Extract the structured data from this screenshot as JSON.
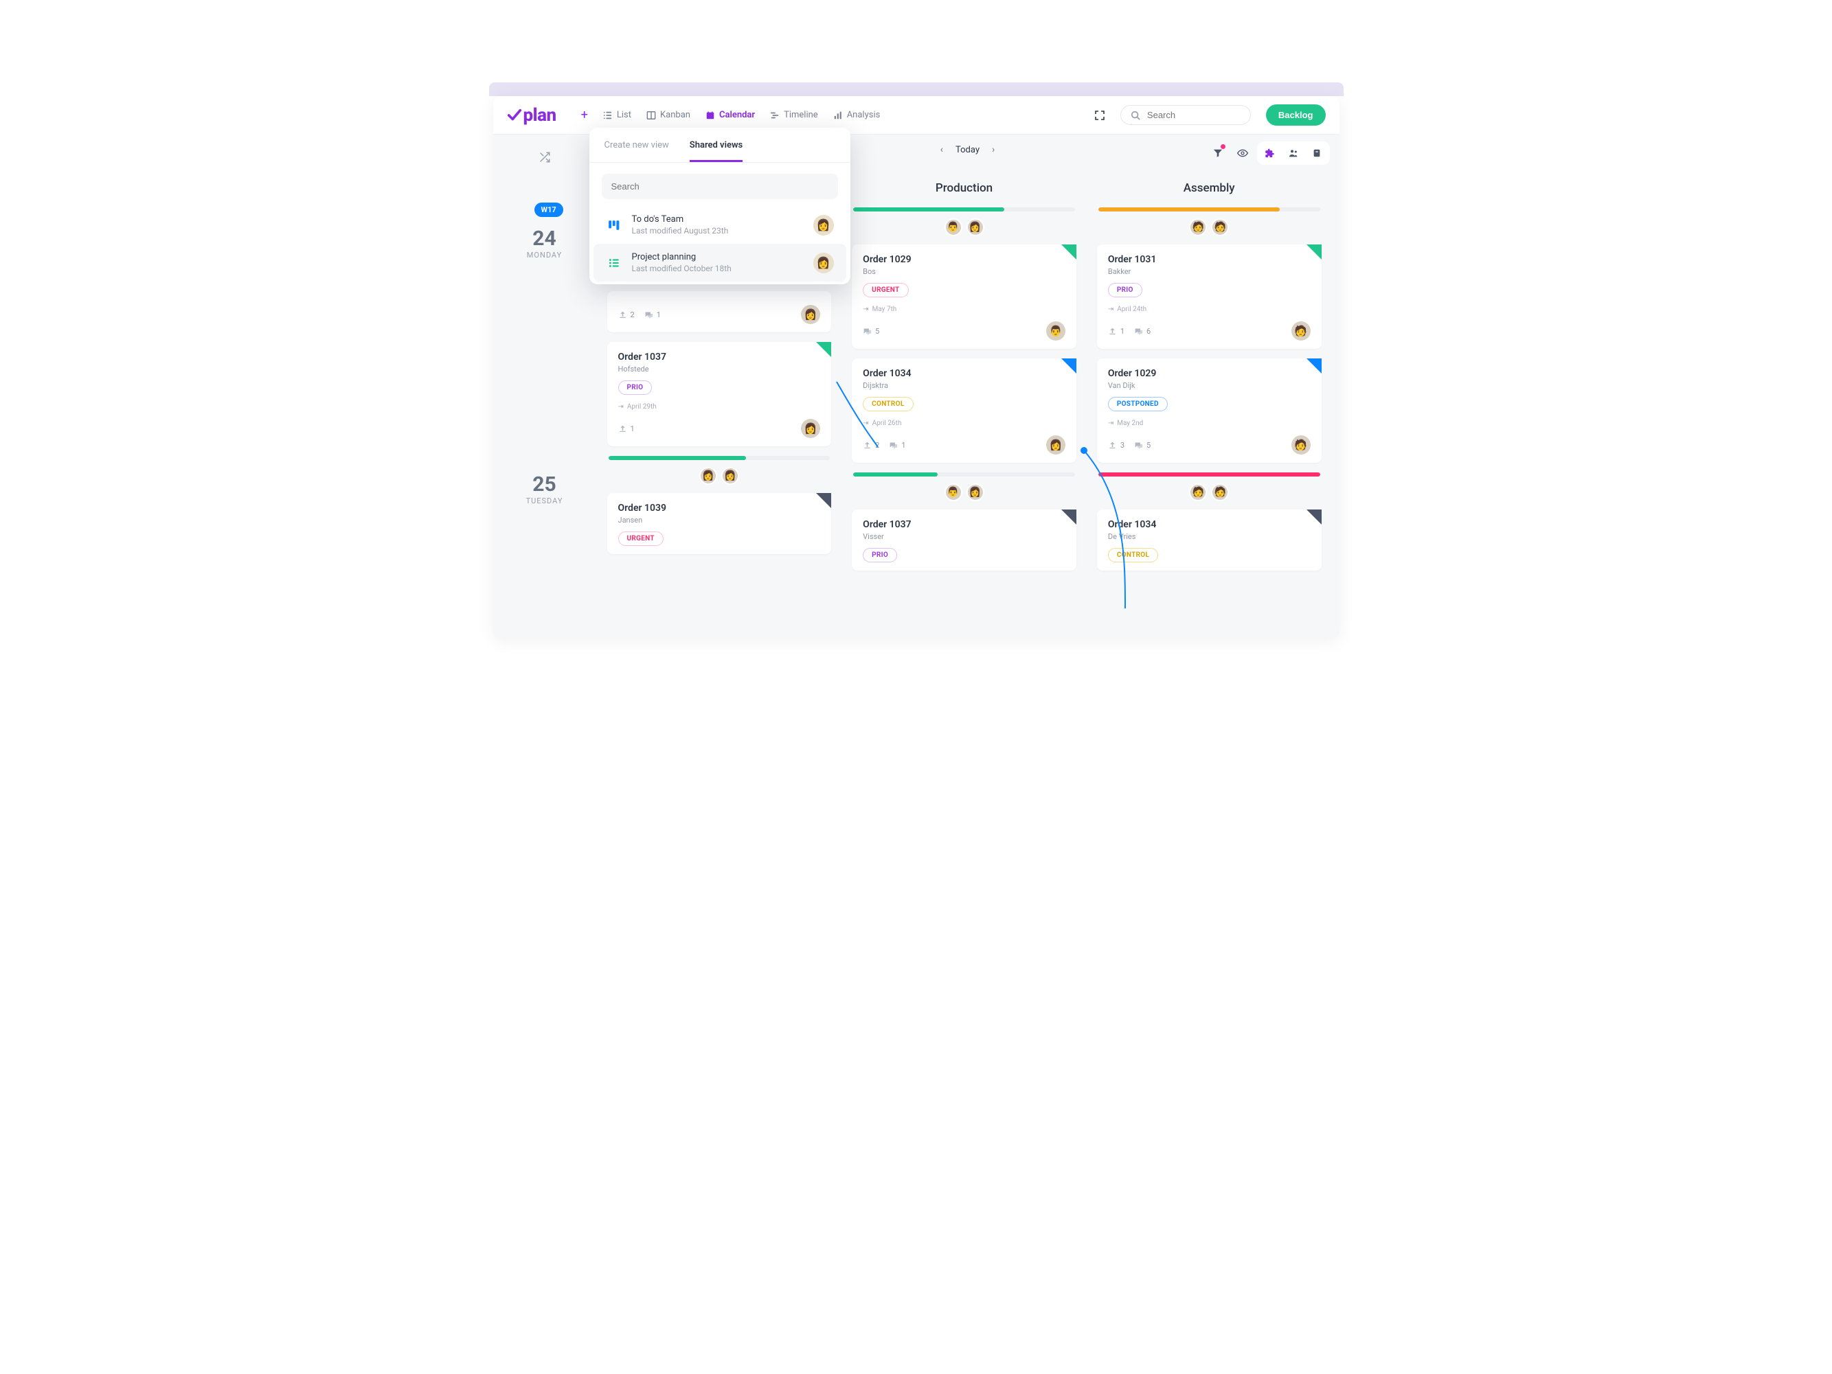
{
  "brand": "plan",
  "nav": {
    "list": "List",
    "kanban": "Kanban",
    "calendar": "Calendar",
    "timeline": "Timeline",
    "analysis": "Analysis"
  },
  "search_placeholder": "Search",
  "backlog_label": "Backlog",
  "today_label": "Today",
  "week_badge": "W17",
  "days": [
    {
      "num": "24",
      "name": "MONDAY"
    },
    {
      "num": "25",
      "name": "TUESDAY"
    }
  ],
  "dropdown": {
    "tab_create": "Create new view",
    "tab_shared": "Shared views",
    "search_placeholder": "Search",
    "items": [
      {
        "title": "To do's Team",
        "sub": "Last modified August 23th"
      },
      {
        "title": "Project planning",
        "sub": "Last modified October 18th"
      }
    ]
  },
  "columns": {
    "production": "Production",
    "assembly": "Assembly"
  },
  "col1": {
    "day1": {
      "card2": {
        "title": "Order 1037",
        "sub": "Hofstede",
        "tag": "PRIO",
        "date": "April 29th",
        "uploads": "1"
      },
      "foot_uploads": "2",
      "foot_comments": "1"
    },
    "day2": {
      "card1": {
        "title": "Order 1039",
        "sub": "Jansen",
        "tag": "URGENT"
      }
    }
  },
  "col2": {
    "day1": {
      "card1": {
        "title": "Order 1029",
        "sub": "Bos",
        "tag": "URGENT",
        "date": "May 7th",
        "comments": "5"
      },
      "card2": {
        "title": "Order 1034",
        "sub": "Dijsktra",
        "tag": "CONTROL",
        "date": "April 26th",
        "uploads": "2",
        "comments": "1"
      }
    },
    "day2": {
      "card1": {
        "title": "Order 1037",
        "sub": "Visser",
        "tag": "PRIO"
      }
    }
  },
  "col3": {
    "day1": {
      "card1": {
        "title": "Order 1031",
        "sub": "Bakker",
        "tag": "PRIO",
        "date": "April 24th",
        "uploads": "1",
        "comments": "6"
      },
      "card2": {
        "title": "Order 1029",
        "sub": "Van Dijk",
        "tag": "POSTPONED",
        "date": "May 2nd",
        "uploads": "3",
        "comments": "5"
      }
    },
    "day2": {
      "card1": {
        "title": "Order 1034",
        "sub": "De Vries",
        "tag": "CONTROL"
      }
    }
  },
  "colors": {
    "purple": "#8a2be2",
    "green": "#21c58b",
    "orange": "#f5a623",
    "pink": "#ff2d87",
    "blue": "#0a84ff"
  }
}
